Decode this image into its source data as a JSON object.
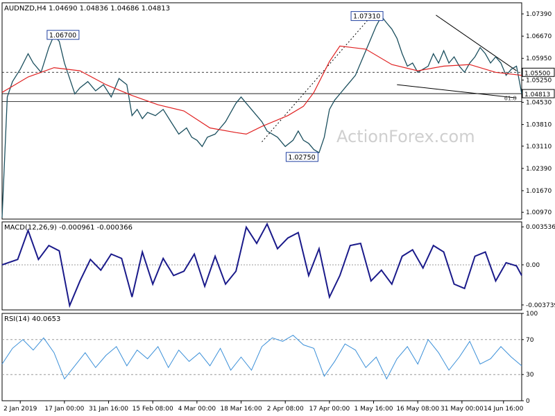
{
  "chart_data": [
    {
      "type": "line",
      "panel": "price",
      "title": "AUDNZD,H4  1.04690 1.04836 1.04686 1.04813",
      "watermark": "ActionForex.com",
      "ylim": [
        1.0075,
        1.0775
      ],
      "y_ticks": [
        "1.07390",
        "1.06670",
        "1.05950",
        "1.05250",
        "1.04530",
        "1.03810",
        "1.03110",
        "1.02390",
        "1.01670",
        "1.00970"
      ],
      "x_ticks": [
        "2 Jan 2019",
        "17 Jan 00:00",
        "31 Jan 16:00",
        "15 Feb 08:00",
        "4 Mar 00:00",
        "18 Mar 16:00",
        "2 Apr 08:00",
        "17 Apr 00:00",
        "1 May 16:00",
        "16 May 08:00",
        "31 May 00:00",
        "14 Jun 16:00"
      ],
      "x_positions": [
        0.035,
        0.12,
        0.205,
        0.29,
        0.375,
        0.46,
        0.545,
        0.63,
        0.715,
        0.8,
        0.885,
        0.965
      ],
      "colors": {
        "price": "#1b4f5e",
        "ma": "#e02020",
        "trend": "#000000"
      },
      "series": [
        {
          "name": "",
          "x": [
            0,
            0.01,
            0.02,
            0.035,
            0.05,
            0.06,
            0.075,
            0.09,
            0.1,
            0.11,
            0.12,
            0.13,
            0.14,
            0.15,
            0.165,
            0.18,
            0.195,
            0.21,
            0.225,
            0.24,
            0.25,
            0.26,
            0.27,
            0.28,
            0.295,
            0.31,
            0.325,
            0.34,
            0.355,
            0.365,
            0.375,
            0.385,
            0.395,
            0.41,
            0.42,
            0.43,
            0.44,
            0.45,
            0.46,
            0.47,
            0.48,
            0.49,
            0.5,
            0.51,
            0.52,
            0.53,
            0.545,
            0.56,
            0.57,
            0.58,
            0.59,
            0.6,
            0.61,
            0.62,
            0.63,
            0.64,
            0.65,
            0.66,
            0.67,
            0.68,
            0.69,
            0.7,
            0.71,
            0.72,
            0.73,
            0.74,
            0.75,
            0.76,
            0.77,
            0.78,
            0.79,
            0.8,
            0.81,
            0.82,
            0.83,
            0.84,
            0.85,
            0.86,
            0.87,
            0.88,
            0.89,
            0.9,
            0.91,
            0.92,
            0.93,
            0.94,
            0.95,
            0.96,
            0.97,
            0.98,
            0.99,
            1.0
          ],
          "values": [
            1.008,
            1.047,
            1.052,
            1.056,
            1.061,
            1.058,
            1.055,
            1.063,
            1.067,
            1.065,
            1.058,
            1.053,
            1.048,
            1.05,
            1.052,
            1.049,
            1.051,
            1.047,
            1.053,
            1.051,
            1.041,
            1.043,
            1.04,
            1.042,
            1.041,
            1.043,
            1.039,
            1.035,
            1.037,
            1.034,
            1.033,
            1.031,
            1.034,
            1.035,
            1.037,
            1.039,
            1.042,
            1.045,
            1.047,
            1.045,
            1.043,
            1.041,
            1.039,
            1.036,
            1.035,
            1.034,
            1.031,
            1.033,
            1.036,
            1.033,
            1.032,
            1.03,
            1.029,
            1.034,
            1.043,
            1.046,
            1.048,
            1.05,
            1.052,
            1.054,
            1.058,
            1.062,
            1.066,
            1.07,
            1.0731,
            1.071,
            1.069,
            1.066,
            1.061,
            1.057,
            1.058,
            1.055,
            1.056,
            1.057,
            1.061,
            1.058,
            1.062,
            1.058,
            1.06,
            1.057,
            1.055,
            1.058,
            1.06,
            1.063,
            1.061,
            1.058,
            1.06,
            1.058,
            1.054,
            1.056,
            1.057,
            1.0481
          ]
        },
        {
          "name": "",
          "x": [
            0.0,
            0.05,
            0.1,
            0.15,
            0.2,
            0.25,
            0.3,
            0.35,
            0.4,
            0.45,
            0.47,
            0.5,
            0.55,
            0.58,
            0.6,
            0.63,
            0.65,
            0.7,
            0.75,
            0.8,
            0.85,
            0.9,
            0.95,
            1.0
          ],
          "values": [
            1.0485,
            1.0535,
            1.0565,
            1.0555,
            1.051,
            1.0475,
            1.0445,
            1.0425,
            1.037,
            1.0355,
            1.035,
            1.0375,
            1.041,
            1.044,
            1.0485,
            1.0585,
            1.0635,
            1.0625,
            1.0575,
            1.0555,
            1.057,
            1.0575,
            1.055,
            1.054
          ]
        }
      ],
      "annotations": [
        {
          "text": "1.06700",
          "x": 0.12,
          "y": 1.067
        },
        {
          "text": "1.02750",
          "x": 0.58,
          "y": 1.0275
        },
        {
          "text": "1.07310",
          "x": 0.705,
          "y": 1.0731
        },
        {
          "text": "61.8",
          "x": 0.985,
          "y": 1.0455
        }
      ],
      "levels": [
        {
          "value": 1.055,
          "label": "1.05500",
          "style": "dashed"
        },
        {
          "value": 1.0481,
          "label": "1.04813",
          "style": "solid"
        },
        {
          "value": 1.0455,
          "label": "",
          "style": "solid"
        }
      ],
      "trendlines": [
        {
          "from": [
            0.5,
            1.0325
          ],
          "to": [
            0.71,
            1.0731
          ],
          "style": "dotted"
        },
        {
          "from": [
            0.835,
            1.0735
          ],
          "to": [
            0.99,
            1.0555
          ],
          "style": "solid"
        },
        {
          "from": [
            0.76,
            1.051
          ],
          "to": [
            0.99,
            1.0467
          ],
          "style": "solid"
        }
      ]
    },
    {
      "type": "line",
      "panel": "macd",
      "title": "MACD(12,26,9) -0.000961 -0.000366",
      "ylim": [
        -0.0042,
        0.004
      ],
      "y_ticks": [
        "0.003536",
        "0.00",
        "-0.003739"
      ],
      "series": [
        {
          "name": "",
          "x": [
            0,
            0.03,
            0.05,
            0.07,
            0.09,
            0.11,
            0.13,
            0.15,
            0.17,
            0.19,
            0.21,
            0.23,
            0.25,
            0.27,
            0.29,
            0.31,
            0.33,
            0.35,
            0.37,
            0.39,
            0.41,
            0.43,
            0.45,
            0.47,
            0.49,
            0.51,
            0.53,
            0.55,
            0.57,
            0.59,
            0.61,
            0.63,
            0.65,
            0.67,
            0.69,
            0.71,
            0.73,
            0.75,
            0.77,
            0.79,
            0.81,
            0.83,
            0.85,
            0.87,
            0.89,
            0.91,
            0.93,
            0.95,
            0.97,
            0.99,
            1.0
          ],
          "values": [
            0,
            0.0005,
            0.0032,
            0.0005,
            0.0018,
            0.0013,
            -0.0038,
            -0.0015,
            0.0005,
            -0.0005,
            0.001,
            0.0006,
            -0.003,
            0.0012,
            -0.0018,
            0.0006,
            -0.001,
            -0.0006,
            0.001,
            -0.002,
            0.0008,
            -0.0018,
            -0.0006,
            0.0035,
            0.002,
            0.0038,
            0.0015,
            0.0025,
            0.003,
            -0.001,
            0.0015,
            -0.003,
            -0.001,
            0.0018,
            0.002,
            -0.0015,
            -0.0005,
            -0.0018,
            0.0008,
            0.0014,
            -0.0003,
            0.0018,
            0.0012,
            -0.0018,
            -0.0022,
            0.0008,
            0.0012,
            -0.0015,
            0.0002,
            -0.0001,
            -0.001
          ]
        }
      ]
    },
    {
      "type": "line",
      "panel": "rsi",
      "title": "RSI(14) 40.0653",
      "ylim": [
        0,
        100
      ],
      "y_ticks": [
        "100",
        "70",
        "30",
        "0"
      ],
      "levels": [
        70,
        30
      ],
      "series": [
        {
          "name": "",
          "x": [
            0,
            0.02,
            0.04,
            0.06,
            0.08,
            0.1,
            0.12,
            0.14,
            0.16,
            0.18,
            0.2,
            0.22,
            0.24,
            0.26,
            0.28,
            0.3,
            0.32,
            0.34,
            0.36,
            0.38,
            0.4,
            0.42,
            0.44,
            0.46,
            0.48,
            0.5,
            0.52,
            0.54,
            0.56,
            0.58,
            0.6,
            0.62,
            0.64,
            0.66,
            0.68,
            0.7,
            0.72,
            0.74,
            0.76,
            0.78,
            0.8,
            0.82,
            0.84,
            0.86,
            0.88,
            0.9,
            0.92,
            0.94,
            0.96,
            0.98,
            1.0
          ],
          "values": [
            42,
            60,
            70,
            58,
            72,
            55,
            25,
            40,
            55,
            38,
            52,
            62,
            40,
            58,
            48,
            62,
            38,
            58,
            45,
            55,
            40,
            60,
            35,
            50,
            35,
            62,
            72,
            68,
            75,
            64,
            60,
            28,
            45,
            65,
            58,
            38,
            50,
            25,
            48,
            62,
            42,
            70,
            55,
            35,
            50,
            68,
            42,
            48,
            62,
            50,
            40
          ]
        }
      ]
    }
  ]
}
